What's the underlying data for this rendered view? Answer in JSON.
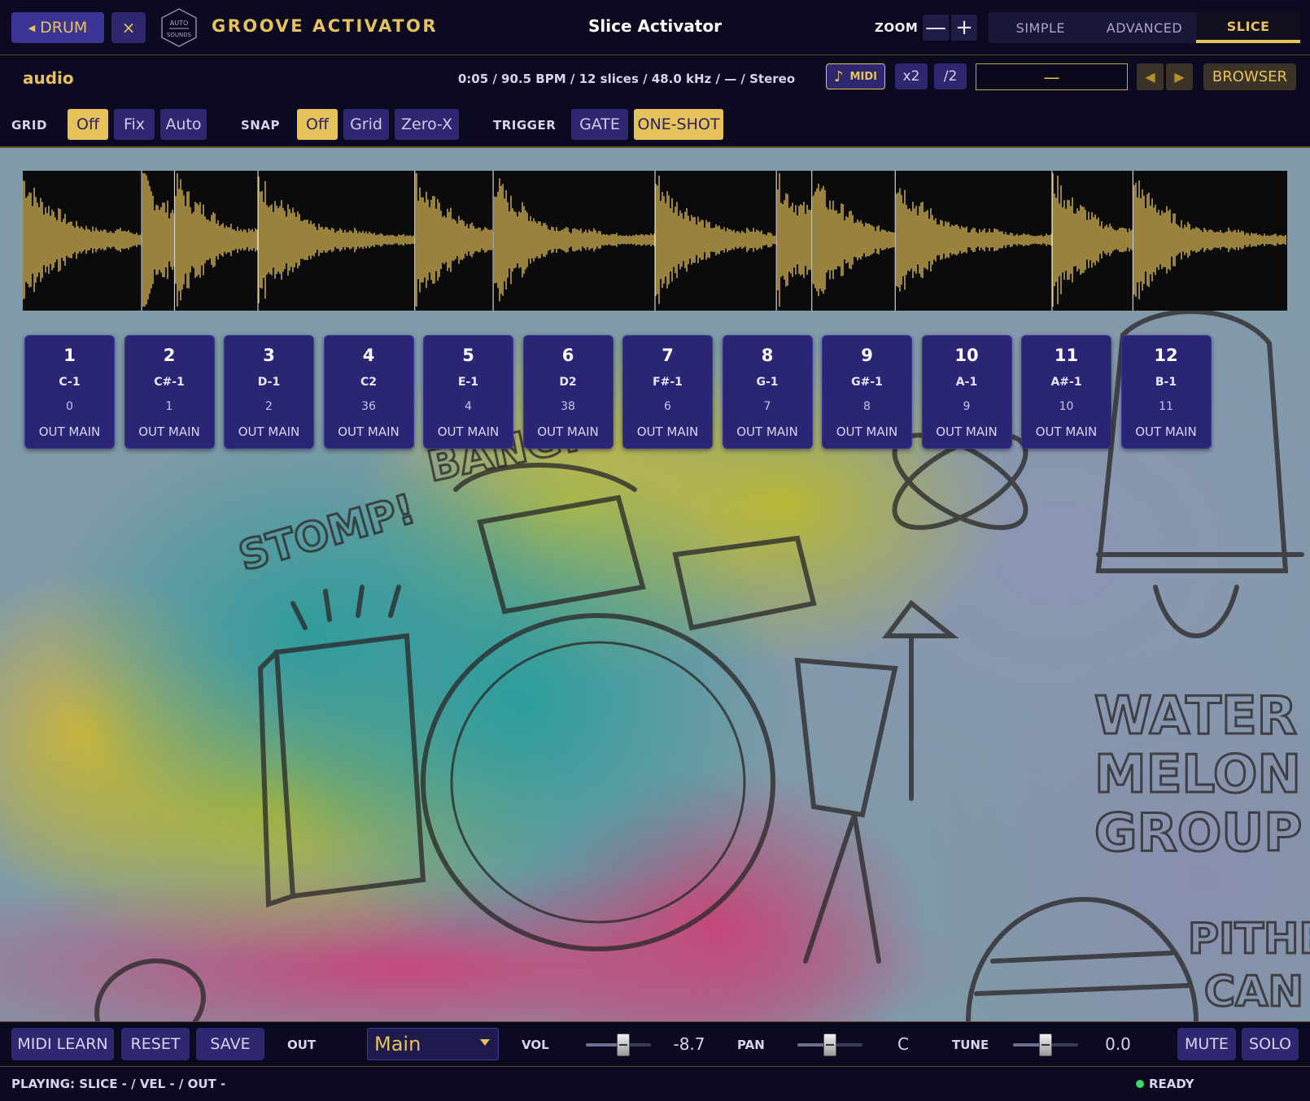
{
  "header": {
    "back_label": "DRUM",
    "close_symbol": "×",
    "logo_text": [
      "AUTO",
      "SOUNDS"
    ],
    "brand_title": "GROOVE ACTIVATOR",
    "view_title": "Slice Activator",
    "zoom_label": "ZOOM",
    "zoom_out_symbol": "—",
    "zoom_in_symbol": "+",
    "mode_tabs": [
      {
        "label": "SIMPLE",
        "active": false
      },
      {
        "label": "ADVANCED",
        "active": false
      },
      {
        "label": "SLICE",
        "active": true
      }
    ]
  },
  "info": {
    "source_label": "audio",
    "file_info": "0:05 / 90.5 BPM / 12 slices / 48.0 kHz / — / Stereo",
    "midi_label": "MIDI",
    "x2_label": "x2",
    "div2_label": "/2",
    "sample_name": "—",
    "prev_symbol": "◀",
    "next_symbol": "▶",
    "browser_label": "BROWSER"
  },
  "options": {
    "grid_label": "GRID",
    "grid_buttons": [
      {
        "label": "Off",
        "on": true
      },
      {
        "label": "Fix",
        "on": false
      },
      {
        "label": "Auto",
        "on": false
      }
    ],
    "snap_label": "SNAP",
    "snap_buttons": [
      {
        "label": "Off",
        "on": true
      },
      {
        "label": "Grid",
        "on": false
      },
      {
        "label": "Zero-X",
        "on": false
      }
    ],
    "trigger_label": "TRIGGER",
    "trigger_buttons": [
      {
        "label": "GATE",
        "on": false
      },
      {
        "label": "ONE-SHOT",
        "on": true
      }
    ]
  },
  "waveform": {
    "color": "#e6c25a",
    "slice_markers_sec": [
      0.47,
      0.6,
      0.93,
      1.55,
      1.86,
      2.5,
      2.98,
      3.12,
      3.45,
      4.07,
      4.39
    ]
  },
  "slices": [
    {
      "num": "1",
      "note": "C-1",
      "midi": "0",
      "out": "OUT MAIN"
    },
    {
      "num": "2",
      "note": "C#-1",
      "midi": "1",
      "out": "OUT MAIN"
    },
    {
      "num": "3",
      "note": "D-1",
      "midi": "2",
      "out": "OUT MAIN"
    },
    {
      "num": "4",
      "note": "C2",
      "midi": "36",
      "out": "OUT MAIN"
    },
    {
      "num": "5",
      "note": "E-1",
      "midi": "4",
      "out": "OUT MAIN"
    },
    {
      "num": "6",
      "note": "D2",
      "midi": "38",
      "out": "OUT MAIN"
    },
    {
      "num": "7",
      "note": "F#-1",
      "midi": "6",
      "out": "OUT MAIN"
    },
    {
      "num": "8",
      "note": "G-1",
      "midi": "7",
      "out": "OUT MAIN"
    },
    {
      "num": "9",
      "note": "G#-1",
      "midi": "8",
      "out": "OUT MAIN"
    },
    {
      "num": "10",
      "note": "A-1",
      "midi": "9",
      "out": "OUT MAIN"
    },
    {
      "num": "11",
      "note": "A#-1",
      "midi": "10",
      "out": "OUT MAIN"
    },
    {
      "num": "12",
      "note": "B-1",
      "midi": "11",
      "out": "OUT MAIN"
    }
  ],
  "artwork": {
    "texts": [
      "BANG!",
      "STOMP!",
      "WATER",
      "MELON",
      "GROUP",
      "PITHE",
      "CAN"
    ]
  },
  "bottom": {
    "midi_learn_label": "MIDI LEARN",
    "reset_label": "RESET",
    "save_label": "SAVE",
    "out_label": "OUT",
    "out_value": "Main",
    "vol_label": "VOL",
    "vol_value": "-8.7",
    "vol_level": 0.58,
    "pan_label": "PAN",
    "pan_value": "C",
    "pan_level": 0.5,
    "tune_label": "TUNE",
    "tune_value": "0.0",
    "tune_level": 0.5,
    "mute_label": "MUTE",
    "solo_label": "SOLO"
  },
  "status": {
    "playing_text": "PLAYING: SLICE - / VEL - / OUT -",
    "ready_text": "READY",
    "ready_color": "#3ddc68"
  }
}
